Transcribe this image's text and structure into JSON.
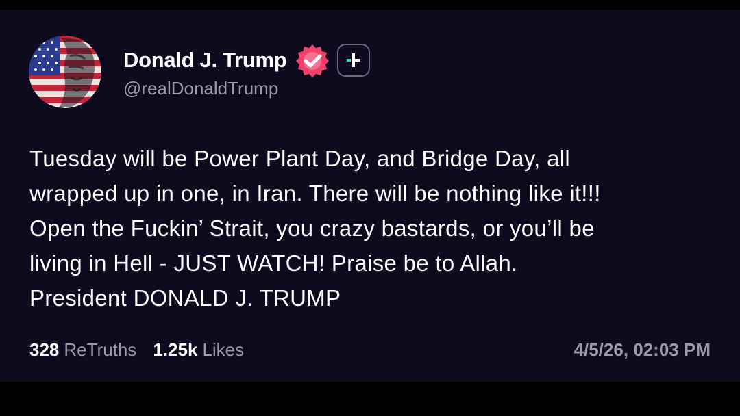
{
  "user": {
    "display_name": "Donald J. Trump",
    "handle": "@realDonaldTrump",
    "avatar_icon": "flag-portrait-avatar",
    "verified_icon": "verified-badge-icon",
    "follow_icon": "plus-icon"
  },
  "post": {
    "lines": [
      "Tuesday will be Power Plant Day, and Bridge Day, all",
      "wrapped up in one, in Iran. There will be nothing like it!!!",
      "Open the Fuckin’ Strait, you crazy bastards, or you’ll be",
      "living in Hell - JUST WATCH! Praise be to Allah.",
      "President DONALD J. TRUMP"
    ]
  },
  "stats": {
    "retruths_count": "328",
    "retruths_label": "ReTruths",
    "likes_count": "1.25k",
    "likes_label": "Likes"
  },
  "timestamp": "4/5/26, 02:03 PM",
  "colors": {
    "background": "#0e0b1e",
    "verified_badge": "#f0416c",
    "follow_plus_accent": "#3ee0c8",
    "muted_text": "#9a98ab"
  }
}
